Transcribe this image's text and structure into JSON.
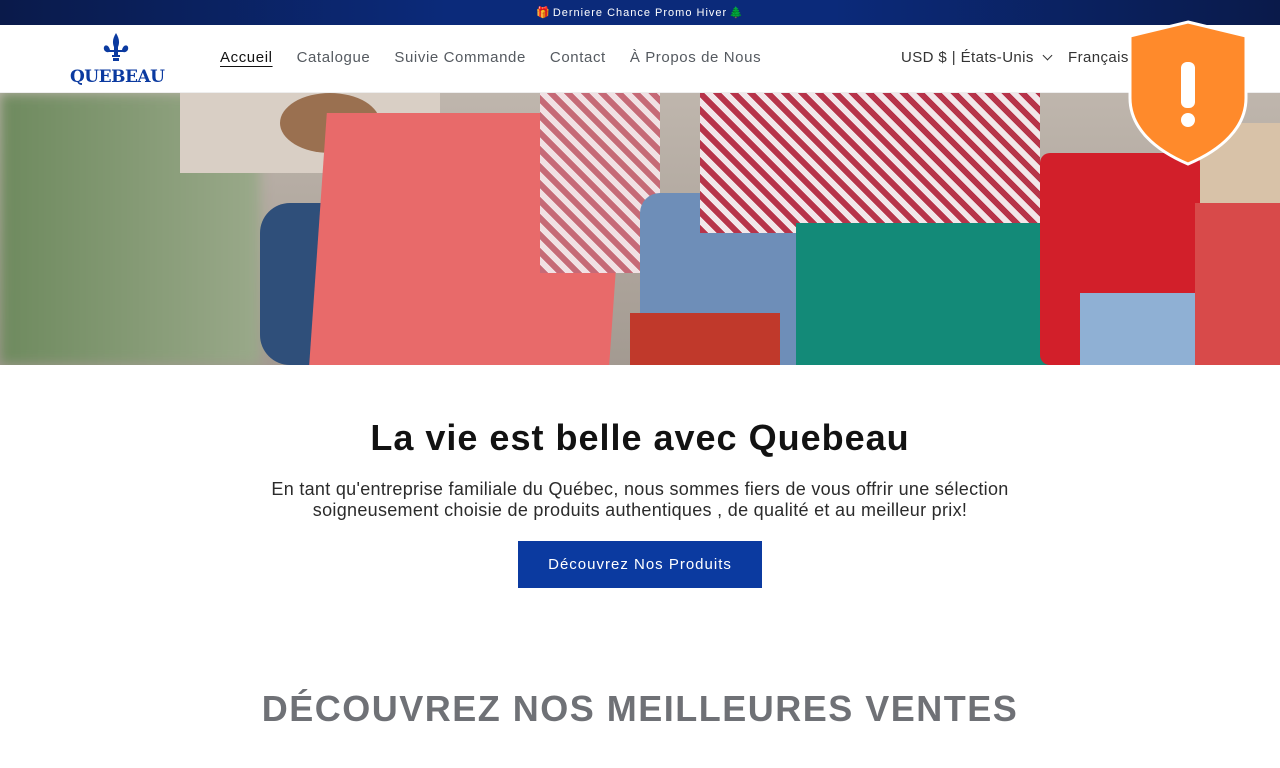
{
  "announcement": {
    "text": "Derniere Chance Promo Hiver",
    "gift_icon": "🎁",
    "tree_icon": "🌲"
  },
  "brand": {
    "name": "QUEBEAU",
    "icon": "fleur-de-lis-icon",
    "color": "#0b3aa0"
  },
  "nav": {
    "items": [
      {
        "label": "Accueil",
        "active": true
      },
      {
        "label": "Catalogue"
      },
      {
        "label": "Suivie Commande"
      },
      {
        "label": "Contact"
      },
      {
        "label": "À Propos de Nous"
      }
    ]
  },
  "header": {
    "currency": "USD $ | États-Unis",
    "language": "Français"
  },
  "security_badge": {
    "icon": "warning-shield-icon",
    "symbol": "!",
    "color": "#ff8a2b"
  },
  "intro": {
    "title": "La vie est belle avec Quebeau",
    "description": "En tant qu'entreprise familiale du Québec, nous sommes fiers de vous offrir une sélection soigneusement choisie de produits authentiques , de qualité et au meilleur prix!",
    "cta_label": "Découvrez Nos Produits"
  },
  "section": {
    "title": "DÉCOUVREZ NOS MEILLEURES VENTES"
  }
}
